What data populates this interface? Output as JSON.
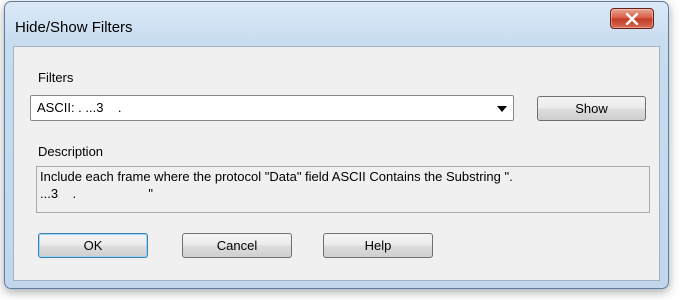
{
  "window": {
    "title": "Hide/Show Filters",
    "close_icon": "close-icon"
  },
  "filters": {
    "label": "Filters",
    "selected_value": "ASCII: . ...3    .",
    "show_button": "Show"
  },
  "description": {
    "label": "Description",
    "text": "Include each frame where the protocol \"Data\" field ASCII Contains the Substring \".\n...3    .                    \""
  },
  "buttons": {
    "ok": "OK",
    "cancel": "Cancel",
    "help": "Help"
  },
  "colors": {
    "title_bar": "#c8dcf0",
    "close_button": "#c9432d",
    "default_button_border": "#3c7fb1"
  }
}
